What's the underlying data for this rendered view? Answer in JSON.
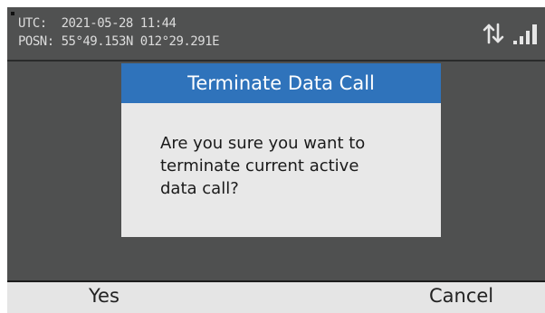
{
  "status": {
    "utc_label": "UTC:",
    "utc_value": "2021-05-28 11:44",
    "posn_label": "POSN:",
    "posn_value": "55°49.153N 012°29.291E",
    "icons": [
      "data-transfer-arrows-icon",
      "signal-strength-icon"
    ]
  },
  "dialog": {
    "title": "Terminate Data Call",
    "message_lines": [
      "Are you sure you want to",
      "terminate current active",
      "data call?"
    ]
  },
  "softkeys": {
    "left_label": "Yes",
    "right_label": "Cancel"
  },
  "colors": {
    "screen_bg": "#4f5050",
    "dialog_header": "#2f73bb",
    "dialog_body": "#e8e8e8",
    "softkey_bar": "#e5e5e5"
  }
}
